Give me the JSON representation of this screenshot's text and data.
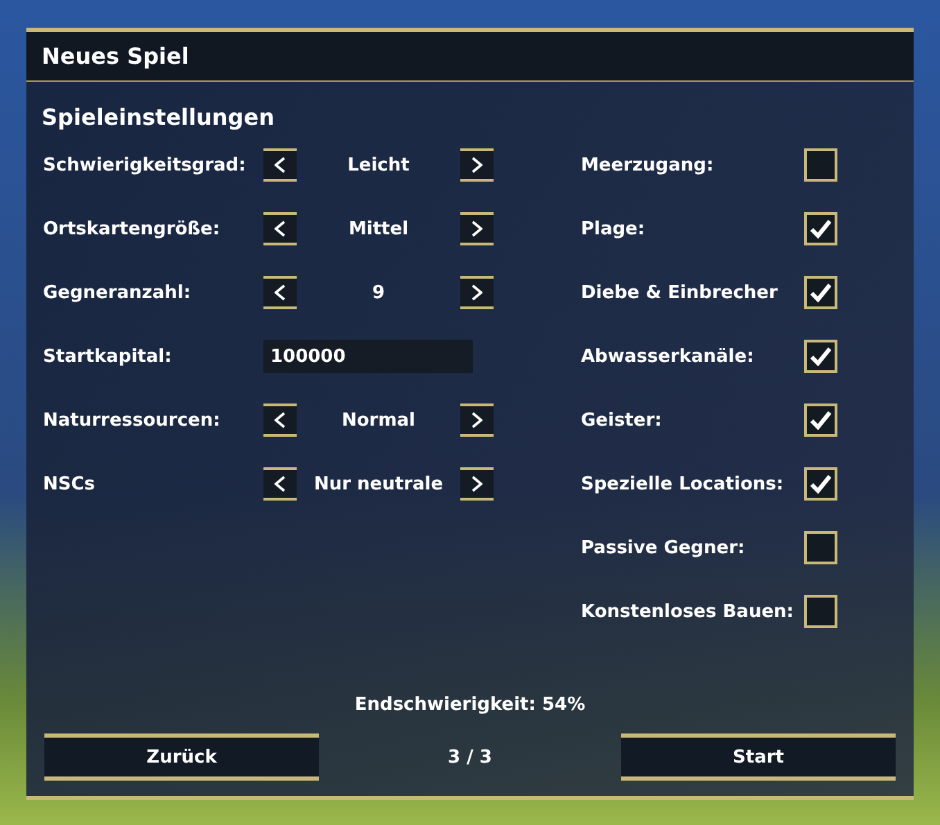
{
  "window": {
    "title": "Neues Spiel"
  },
  "section_title": "Spieleinstellungen",
  "left_settings": [
    {
      "kind": "selector",
      "label": "Schwierigkeitsgrad:",
      "value": "Leicht"
    },
    {
      "kind": "selector",
      "label": "Ortskartengröße:",
      "value": "Mittel"
    },
    {
      "kind": "selector",
      "label": "Gegneranzahl:",
      "value": "9"
    },
    {
      "kind": "input",
      "label": "Startkapital:",
      "value": "100000"
    },
    {
      "kind": "selector",
      "label": "Naturressourcen:",
      "value": "Normal"
    },
    {
      "kind": "selector",
      "label": "NSCs",
      "value": "Nur neutrale"
    }
  ],
  "right_settings": [
    {
      "label": "Meerzugang:",
      "checked": false
    },
    {
      "label": "Plage:",
      "checked": true
    },
    {
      "label": "Diebe & Einbrecher",
      "checked": true
    },
    {
      "label": "Abwasserkanäle:",
      "checked": true
    },
    {
      "label": "Geister:",
      "checked": true
    },
    {
      "label": "Spezielle Locations:",
      "checked": true
    },
    {
      "label": "Passive Gegner:",
      "checked": false
    },
    {
      "label": "Konstenloses Bauen:",
      "checked": false
    }
  ],
  "final_difficulty": "Endschwierigkeit: 54%",
  "back_button": "Zurück",
  "page_indicator": "3 / 3",
  "start_button": "Start"
}
